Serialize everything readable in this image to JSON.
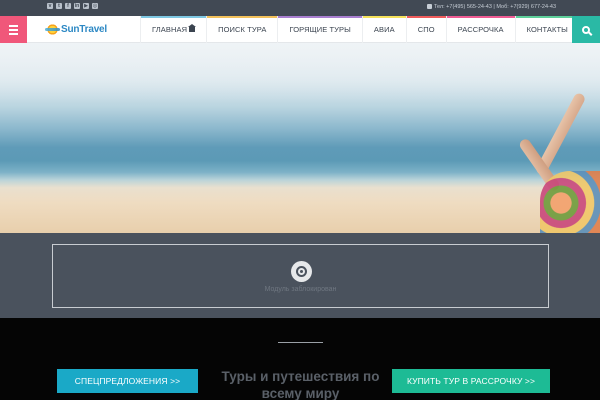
{
  "topbar": {
    "social": [
      "vk",
      "twitter",
      "facebook",
      "linkedin",
      "youtube",
      "instagram"
    ],
    "contacts": "Тел: +7(495) 565-24-43 | Моб: +7(929) 677-24-43"
  },
  "header": {
    "logo_text": "SunTravel",
    "menu": [
      {
        "label": "ГЛАВНАЯ",
        "accent": "#7ec8e3"
      },
      {
        "label": "ПОИСК ТУРА",
        "accent": "#f3c15b"
      },
      {
        "label": "ГОРЯЩИЕ ТУРЫ",
        "accent": "#a97fd1"
      },
      {
        "label": "АВИА",
        "accent": "#f5e15a"
      },
      {
        "label": "СПО",
        "accent": "#ef5b5b"
      },
      {
        "label": "РАССРОЧКА",
        "accent": "#ef5b93"
      },
      {
        "label": "КОНТАКТЫ",
        "accent": "#5ed09b"
      }
    ]
  },
  "module": {
    "message": "Модуль заблокирован"
  },
  "lower": {
    "special_button": "СПЕЦПРЕДЛОЖЕНИЯ >>",
    "tagline": "Туры и путешествия по всему миру",
    "credit_button": "КУПИТЬ ТУР В РАССРОЧКУ >>"
  },
  "colors": {
    "menu_button": "#f0577a",
    "search_button": "#2ab9a5",
    "special_button": "#1aa9c7",
    "credit_button": "#1dbb95"
  }
}
